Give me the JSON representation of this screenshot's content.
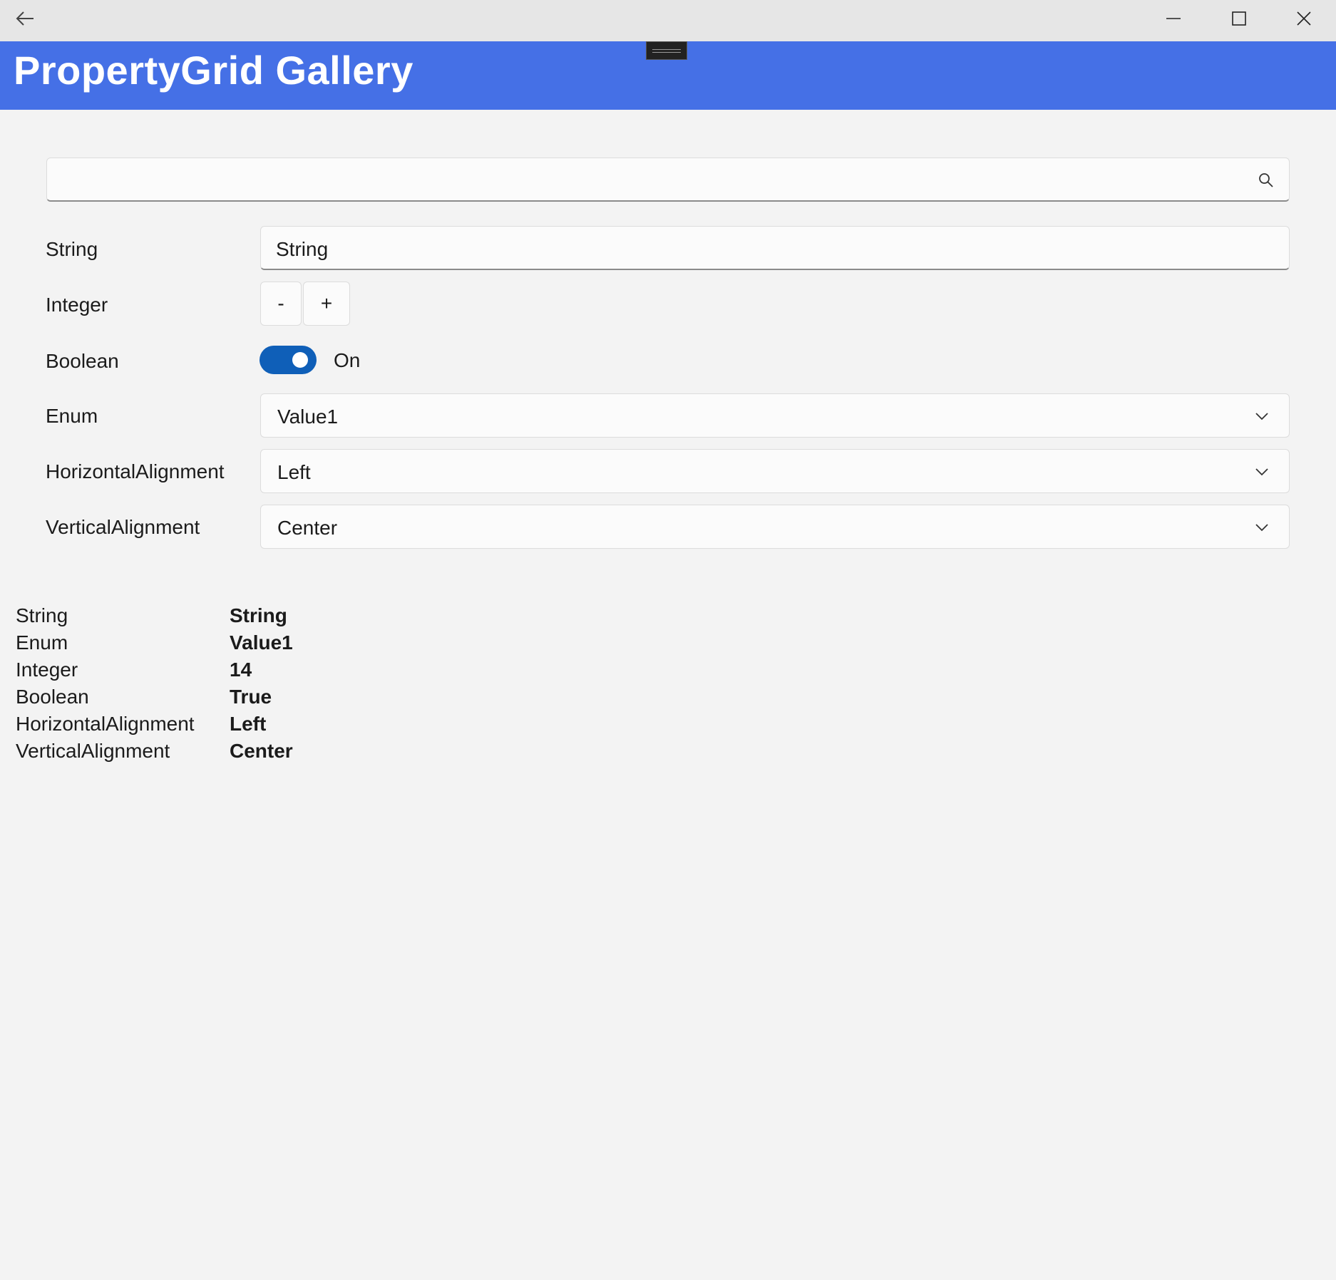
{
  "window": {
    "back_icon": "back-arrow-icon",
    "minimize_icon": "minimize-icon",
    "maximize_icon": "maximize-icon",
    "close_icon": "close-icon"
  },
  "header": {
    "title": "PropertyGrid Gallery",
    "background_color": "#4570e6"
  },
  "search": {
    "value": "",
    "placeholder": "",
    "icon": "search-icon"
  },
  "properties": {
    "string": {
      "label": "String",
      "value": "String"
    },
    "integer": {
      "label": "Integer",
      "decrement_label": "-",
      "increment_label": "+"
    },
    "boolean": {
      "label": "Boolean",
      "state_text": "On",
      "checked": true,
      "accent_color": "#0f5fb8"
    },
    "enum": {
      "label": "Enum",
      "selected": "Value1"
    },
    "horizontal_alignment": {
      "label": "HorizontalAlignment",
      "selected": "Left"
    },
    "vertical_alignment": {
      "label": "VerticalAlignment",
      "selected": "Center"
    }
  },
  "summary": [
    {
      "label": "String",
      "value": "String"
    },
    {
      "label": "Enum",
      "value": "Value1"
    },
    {
      "label": "Integer",
      "value": "14"
    },
    {
      "label": "Boolean",
      "value": "True"
    },
    {
      "label": "HorizontalAlignment",
      "value": "Left"
    },
    {
      "label": "VerticalAlignment",
      "value": "Center"
    }
  ]
}
